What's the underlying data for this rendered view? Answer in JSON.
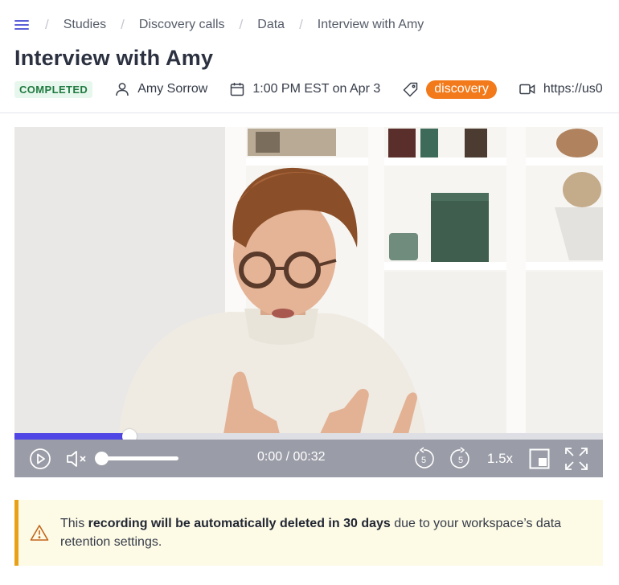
{
  "breadcrumb": {
    "items": [
      "Studies",
      "Discovery calls",
      "Data",
      "Interview with Amy"
    ]
  },
  "page": {
    "title": "Interview with Amy"
  },
  "meta": {
    "status": "COMPLETED",
    "participant": "Amy Sorrow",
    "scheduled": "1:00 PM EST on Apr 3",
    "tag": "discovery",
    "link": "https://us0"
  },
  "player": {
    "current_time": "0:00",
    "duration": "00:32",
    "time_display": "0:00 / 00:32",
    "progress_fraction": 0.195,
    "volume_fraction": 0.0,
    "muted": true,
    "rewind_seconds": "5",
    "forward_seconds": "5",
    "speed": "1.5x"
  },
  "notice": {
    "text_before": "This ",
    "text_bold": "recording will be automatically deleted in 30 days",
    "text_after": " due to your workspace’s data retention settings."
  },
  "colors": {
    "accent": "#4f46e5",
    "tag": "#f27a1a",
    "status_text": "#1f7a3f",
    "status_bg": "#e8f7ee",
    "notice_border": "#e6a117",
    "notice_bg": "#fdfbe6",
    "controls_bg": "#9a9ca7"
  }
}
